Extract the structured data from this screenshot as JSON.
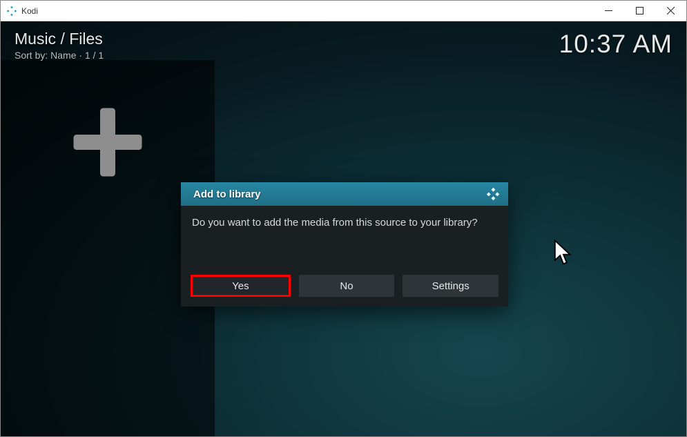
{
  "window": {
    "title": "Kodi"
  },
  "header": {
    "breadcrumb": "Music / Files",
    "sort_line": "Sort by: Name  ·  1 / 1",
    "clock": "10:37 AM"
  },
  "dialog": {
    "title": "Add to library",
    "message": "Do you want to add the media from this source to your library?",
    "buttons": {
      "yes": "Yes",
      "no": "No",
      "settings": "Settings"
    }
  }
}
